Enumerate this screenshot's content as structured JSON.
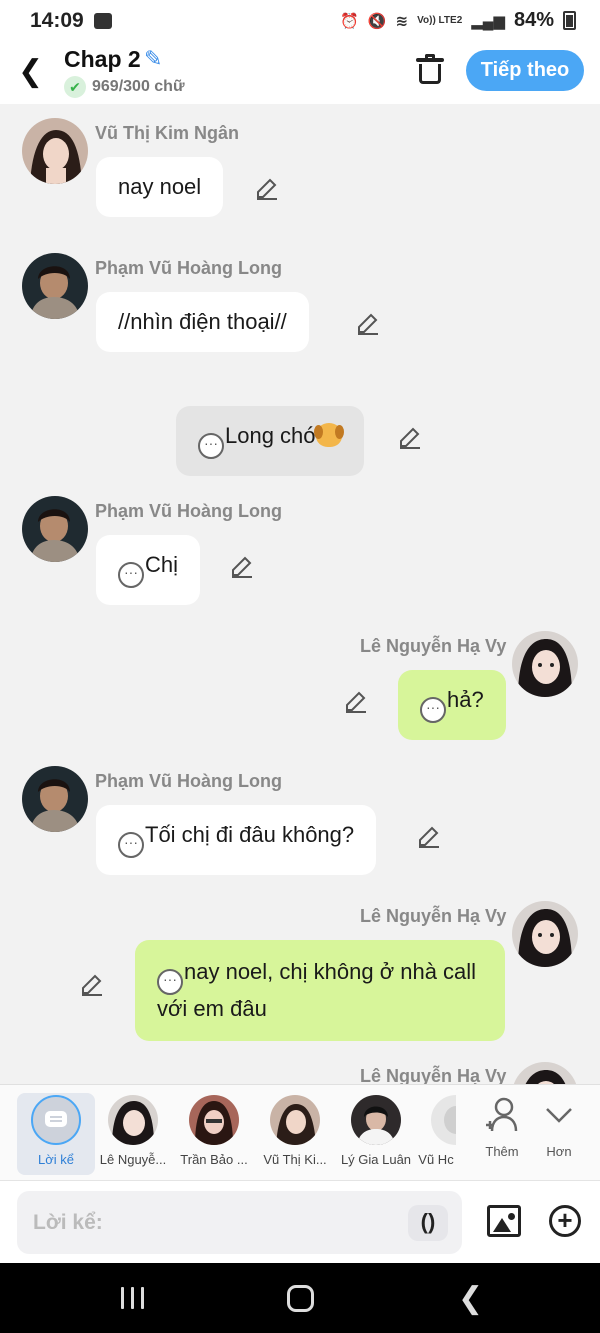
{
  "status_bar": {
    "time": "14:09",
    "network_label": "Vo)) LTE2",
    "battery": "84%"
  },
  "header": {
    "title": "Chap 2",
    "word_count": "969/300 chữ",
    "next_button": "Tiếp theo"
  },
  "messages": [
    {
      "name": "Vũ Thị Kim Ngân",
      "text": "nay noel",
      "side": "left"
    },
    {
      "name": "Phạm Vũ Hoàng Long",
      "text": "//nhìn điện thoại//",
      "side": "left"
    },
    {
      "name": "",
      "text": "Long chó",
      "side": "center"
    },
    {
      "name": "Phạm Vũ Hoàng Long",
      "text": "Chị",
      "side": "left"
    },
    {
      "name": "Lê Nguyễn Hạ Vy",
      "text": "hả?",
      "side": "right"
    },
    {
      "name": "Phạm Vũ Hoàng Long",
      "text": "Tối chị đi đâu không?",
      "side": "left"
    },
    {
      "name": "Lê Nguyễn Hạ Vy",
      "text": "nay noel, chị không ở nhà call với em đâu",
      "side": "right"
    },
    {
      "name": "Lê Nguyễn Hạ Vy",
      "text": "",
      "side": "right"
    }
  ],
  "characters": [
    {
      "label": "Lời kể",
      "active": true
    },
    {
      "label": "Lê Nguyễ...",
      "active": false
    },
    {
      "label": "Trần Bảo ...",
      "active": false
    },
    {
      "label": "Vũ Thị Ki...",
      "active": false
    },
    {
      "label": "Lý Gia Luân",
      "active": false
    },
    {
      "label": "Vũ Hc",
      "active": false
    }
  ],
  "character_actions": {
    "add_label": "Thêm",
    "more_label": "Hơn"
  },
  "input": {
    "placeholder": "Lời kể:",
    "paren_label": "()"
  },
  "colors": {
    "accent": "#4ba7f5",
    "green_bubble": "#d7f59a",
    "background": "#f2f2f2"
  }
}
